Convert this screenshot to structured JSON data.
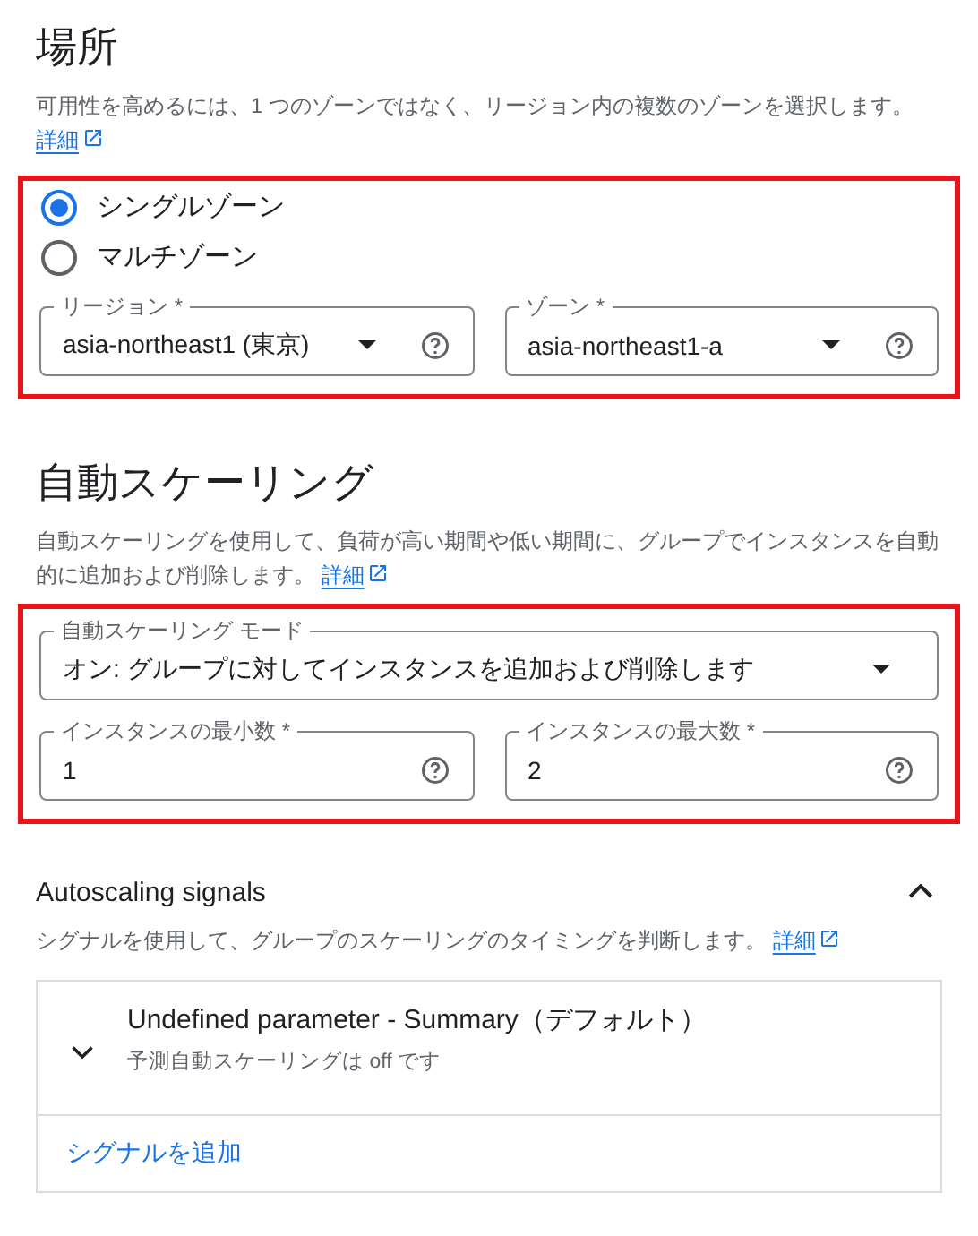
{
  "location": {
    "title": "場所",
    "description": "可用性を高めるには、1 つのゾーンではなく、リージョン内の複数のゾーンを選択します。",
    "link": "詳細",
    "zone_options": [
      {
        "label": "シングルゾーン",
        "selected": true
      },
      {
        "label": "マルチゾーン",
        "selected": false
      }
    ],
    "fields": [
      {
        "label": "リージョン *",
        "value": "asia-northeast1 (東京)",
        "kind": "select",
        "help": true
      },
      {
        "label": "ゾーン *",
        "value": "asia-northeast1-a",
        "kind": "select",
        "help": true
      }
    ]
  },
  "autoscaling": {
    "title": "自動スケーリング",
    "description": "自動スケーリングを使用して、負荷が高い期間や低い期間に、グループでインスタンスを自動的に追加および削除します。",
    "link": "詳細",
    "mode_fields": [
      {
        "label": "自動スケーリング モード",
        "value": "オン: グループに対してインスタンスを追加および削除します",
        "kind": "select",
        "help": false
      }
    ],
    "fields": [
      {
        "label": "インスタンスの最小数 *",
        "value": "1",
        "kind": "number",
        "help": true
      },
      {
        "label": "インスタンスの最大数 *",
        "value": "2",
        "kind": "number",
        "help": true
      }
    ]
  },
  "signals": {
    "title": "Autoscaling signals",
    "expanded": true,
    "description": "シグナルを使用して、グループのスケーリングのタイミングを判断します。",
    "link": "詳細",
    "items": [
      {
        "title": "Undefined parameter - Summary（デフォルト）",
        "subtitle": "予測自動スケーリングは off です",
        "expanded": false
      }
    ],
    "add_button": "シグナルを追加"
  }
}
